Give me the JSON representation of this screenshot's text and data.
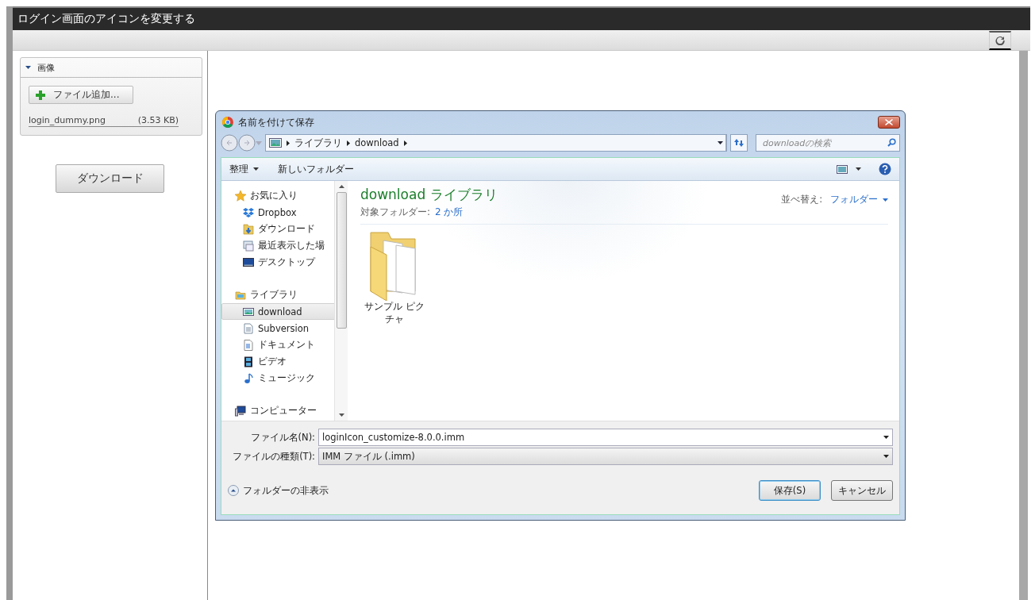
{
  "page": {
    "title": "ログイン画面のアイコンを変更する"
  },
  "image_panel": {
    "title": "画像",
    "expanded": true,
    "add_button": "ファイル追加...",
    "files": [
      {
        "name": "login_dummy.png",
        "size": "(3.53 KB)"
      }
    ]
  },
  "download_button": "ダウンロード",
  "dialog": {
    "title": "名前を付けて保存",
    "breadcrumb": [
      "ライブラリ",
      "download"
    ],
    "search": {
      "placeholder": "downloadの検索"
    },
    "toolbar": {
      "organize": "整理",
      "new_folder": "新しいフォルダー"
    },
    "nav": [
      {
        "label": "お気に入り",
        "kind": "star",
        "selected": false,
        "children": [
          {
            "label": "Dropbox",
            "kind": "dropbox",
            "selected": false
          },
          {
            "label": "ダウンロード",
            "kind": "download",
            "selected": false
          },
          {
            "label": "最近表示した場",
            "kind": "recent",
            "selected": false
          },
          {
            "label": "デスクトップ",
            "kind": "desktop",
            "selected": false
          }
        ]
      },
      {
        "label": "ライブラリ",
        "kind": "library",
        "selected": false,
        "children": [
          {
            "label": "download",
            "kind": "pictures",
            "selected": true
          },
          {
            "label": "Subversion",
            "kind": "documents",
            "selected": false
          },
          {
            "label": "ドキュメント",
            "kind": "document",
            "selected": false
          },
          {
            "label": "ビデオ",
            "kind": "video",
            "selected": false
          },
          {
            "label": "ミュージック",
            "kind": "music",
            "selected": false
          }
        ]
      },
      {
        "label": "コンピューター",
        "kind": "computer",
        "selected": false
      }
    ],
    "heading": "download ライブラリ",
    "subtitle": {
      "label": "対象フォルダー:",
      "link": "2 か所"
    },
    "sort": {
      "label": "並べ替え:",
      "value": "フォルダー"
    },
    "items": [
      {
        "label": "サンプル ピクチャ"
      }
    ],
    "file_name": {
      "label": "ファイル名(N):",
      "value": "loginIcon_customize-8.0.0.imm"
    },
    "file_type": {
      "label": "ファイルの種類(T):",
      "value": "IMM ファイル (.imm)"
    },
    "hide_folders": "フォルダーの非表示",
    "buttons": [
      {
        "label": "保存(S)",
        "default": true
      },
      {
        "label": "キャンセル",
        "default": false
      }
    ]
  }
}
